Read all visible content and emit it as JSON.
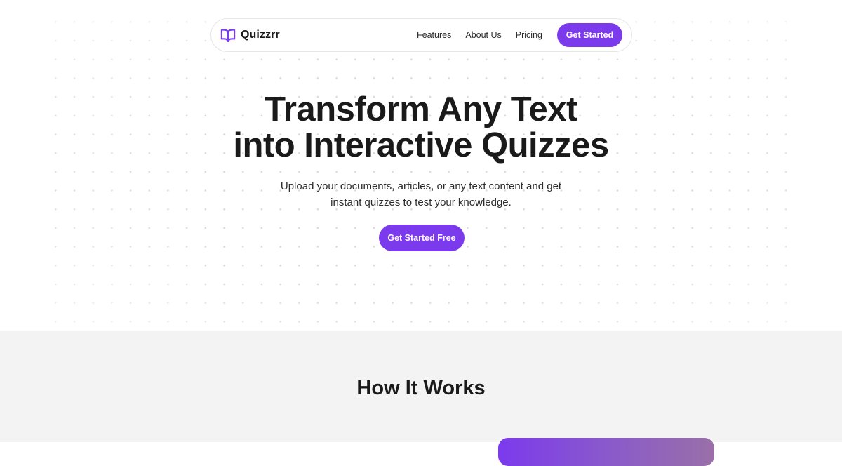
{
  "brand": {
    "name": "Quizzrr",
    "icon": "open-book-icon",
    "accent_color": "#7c3aed"
  },
  "nav": {
    "links": [
      {
        "label": "Features"
      },
      {
        "label": "About Us"
      },
      {
        "label": "Pricing"
      }
    ],
    "cta_label": "Get Started"
  },
  "hero": {
    "headline_line1": "Transform Any Text",
    "headline_line2": "into Interactive Quizzes",
    "subtitle_line1": "Upload your documents, articles, or any text content and get",
    "subtitle_line2": "instant quizzes to test your knowledge.",
    "cta_label": "Get Started Free"
  },
  "how_it_works": {
    "title": "How It Works"
  }
}
